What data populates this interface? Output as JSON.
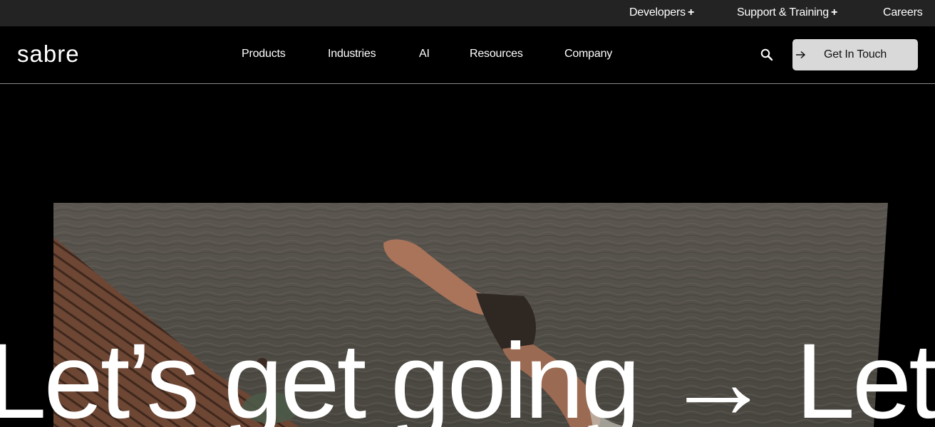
{
  "utility_nav": {
    "developers": "Developers",
    "support": "Support & Training",
    "careers": "Careers",
    "plus": "+"
  },
  "header": {
    "logo_text": "sabre",
    "nav": [
      "Products",
      "Industries",
      "AI",
      "Resources",
      "Company"
    ],
    "cta_label": "Get In Touch"
  },
  "hero": {
    "headline": "Let’s get going → Let’s",
    "image_alt": "man-diving-off-wooden-pier-into-sea"
  },
  "colors": {
    "utility_bg": "#232323",
    "header_bg": "#000000",
    "cta_bg": "#d9d9d9",
    "water": "#4f4c46",
    "pier": "#6a4632"
  }
}
